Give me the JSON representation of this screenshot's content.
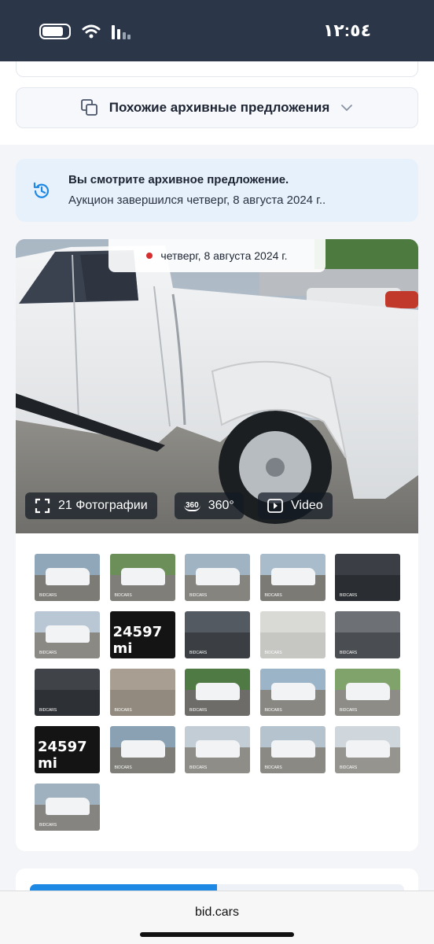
{
  "status_bar": {
    "time": "١٢:٥٤"
  },
  "similar": {
    "label": "Похожие архивные предложения"
  },
  "archive_notice": {
    "title": "Вы смотрите архивное предложение.",
    "subtitle": "Аукцион завершился четверг, 8 августа 2024 г.."
  },
  "gallery": {
    "date_label": "четверг, 8 августа 2024 г.",
    "photos_button": "21 Фотографии",
    "view360_badge": "360",
    "view360_button": "360°",
    "video_button": "Video",
    "watermark": "BIDCARS",
    "odometer_text": "24597 mi",
    "thumbnails": [
      {
        "kind": "front-right"
      },
      {
        "kind": "front-left"
      },
      {
        "kind": "rear-left"
      },
      {
        "kind": "rear-right"
      },
      {
        "kind": "interior"
      },
      {
        "kind": "side"
      },
      {
        "kind": "odometer",
        "text": "24597 mi"
      },
      {
        "kind": "interior-rear"
      },
      {
        "kind": "label"
      },
      {
        "kind": "engine"
      },
      {
        "kind": "dashboard"
      },
      {
        "kind": "part"
      },
      {
        "kind": "front"
      },
      {
        "kind": "side-right"
      },
      {
        "kind": "side-right-far"
      },
      {
        "kind": "odometer",
        "text": "24597 mi"
      },
      {
        "kind": "rear"
      },
      {
        "kind": "damage-side"
      },
      {
        "kind": "side-door"
      },
      {
        "kind": "damage-close"
      },
      {
        "kind": "rear-damage"
      }
    ]
  },
  "browser": {
    "url": "bid.cars"
  },
  "colors": {
    "accent": "#1e88e5",
    "status_bar": "#2b3648",
    "banner": "#e6f1fb"
  }
}
